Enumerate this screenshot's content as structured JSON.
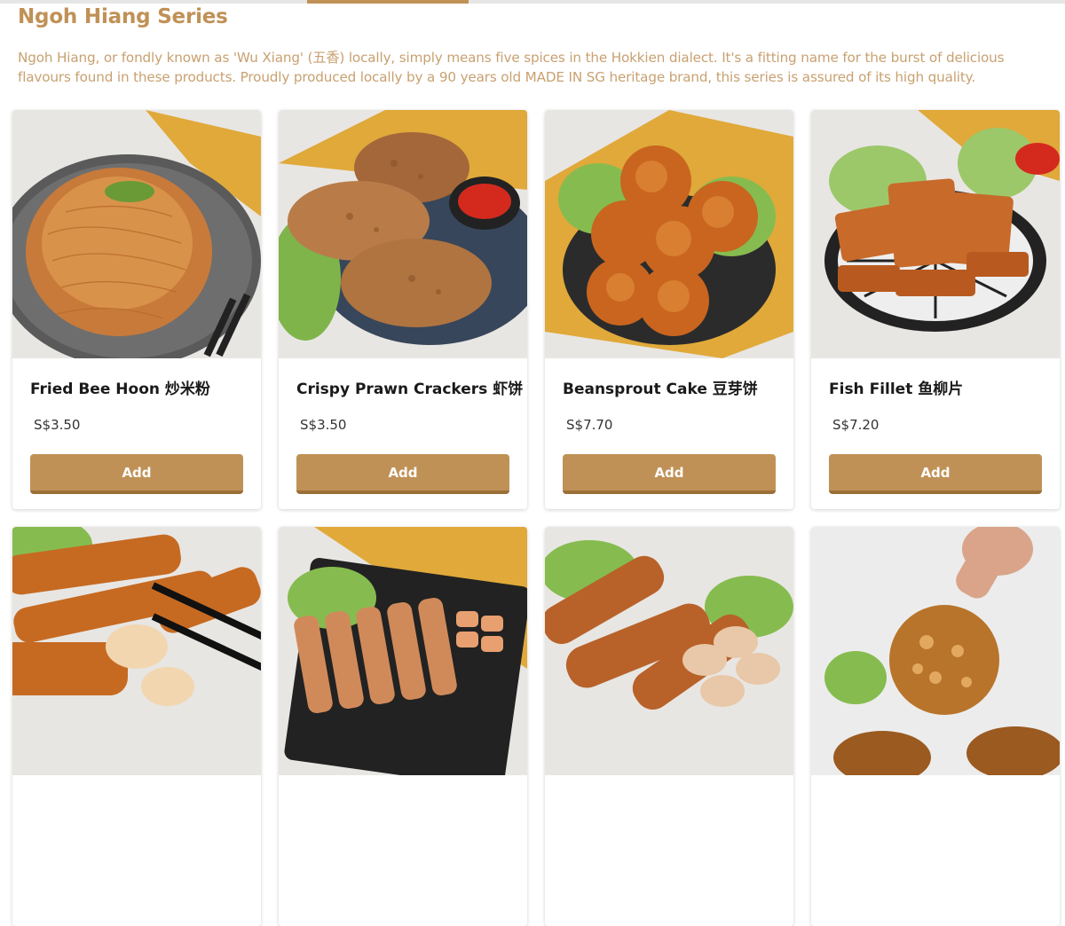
{
  "section": {
    "title": "Ngoh Hiang Series",
    "description": "Ngoh Hiang, or fondly known as 'Wu Xiang' (五香) locally, simply means five spices in the Hokkien dialect. It's a fitting name for the burst of delicious flavours found in these products. Proudly produced locally by a 90 years old MADE IN SG heritage brand, this series is assured of its high quality."
  },
  "colors": {
    "accent": "#c09156",
    "accent_dark": "#9a6f38",
    "description_text": "#c8a171"
  },
  "products": [
    {
      "name": "Fried Bee Hoon 炒米粉",
      "price": "S$3.50",
      "add_label": "Add",
      "image": "fried-bee-hoon-photo"
    },
    {
      "name": "Crispy Prawn Crackers 虾饼",
      "price": "S$3.50",
      "add_label": "Add",
      "image": "prawn-crackers-photo"
    },
    {
      "name": "Beansprout Cake 豆芽饼",
      "price": "S$7.70",
      "add_label": "Add",
      "image": "beansprout-cake-photo"
    },
    {
      "name": "Fish Fillet 鱼柳片",
      "price": "S$7.20",
      "add_label": "Add",
      "image": "fish-fillet-photo"
    },
    {
      "image": "fried-fish-cake-photo"
    },
    {
      "image": "ngoh-hiang-rolls-photo"
    },
    {
      "image": "sausage-rolls-photo"
    },
    {
      "image": "fried-fritter-photo"
    }
  ]
}
